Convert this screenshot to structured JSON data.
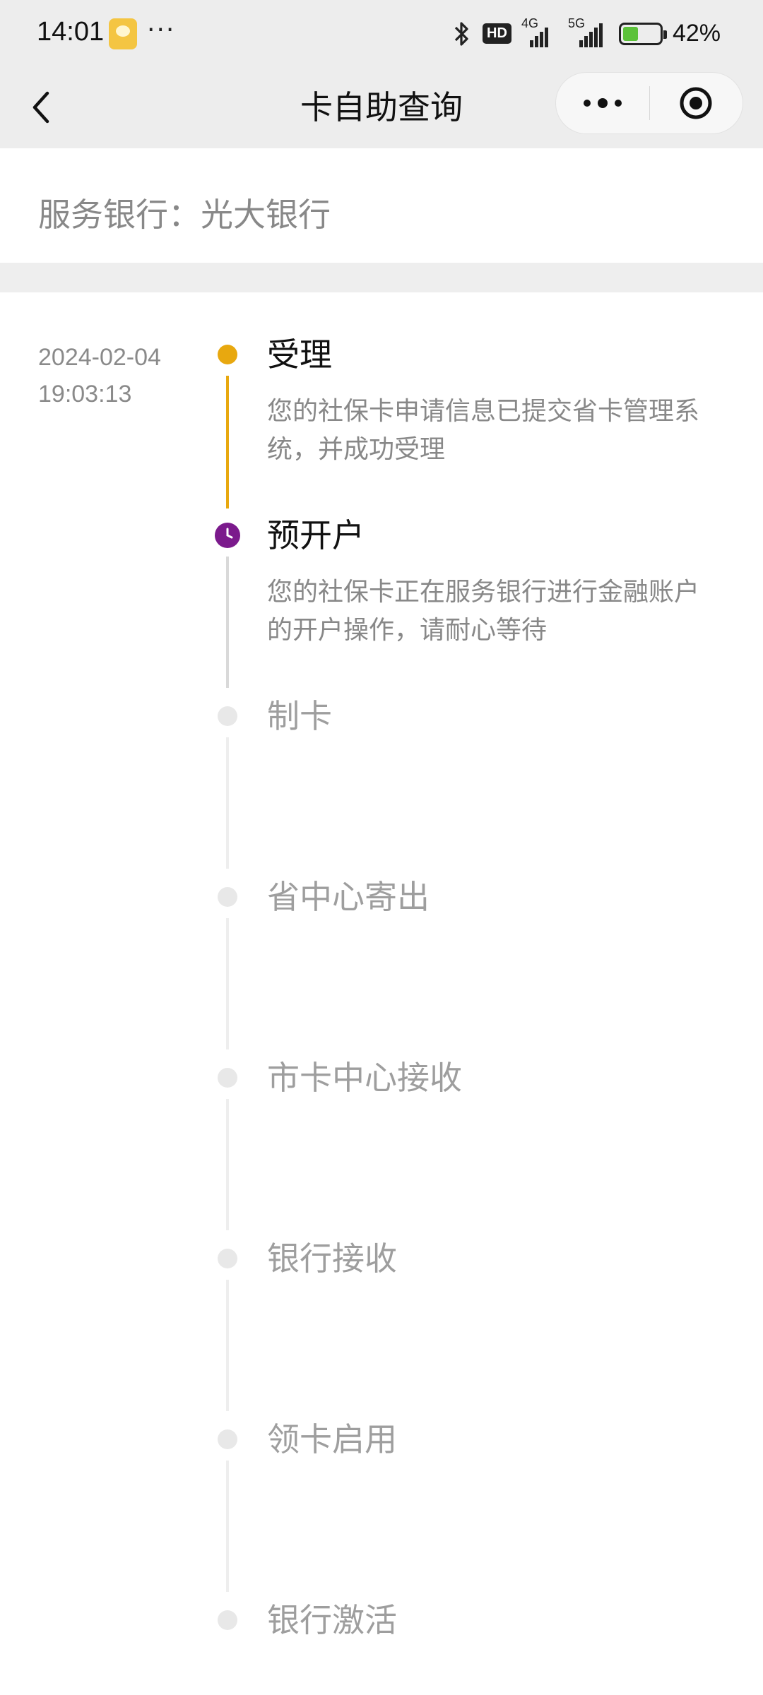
{
  "status_bar": {
    "time": "14:01",
    "dots": "···",
    "hd_label": "HD",
    "net1": "4G",
    "net2": "5G",
    "battery_text": "42%",
    "battery_level": 0.42
  },
  "nav": {
    "title": "卡自助查询",
    "back_icon": "chevron-left-icon",
    "more_icon": "more-dots-icon",
    "close_icon": "target-circle-icon"
  },
  "info": {
    "bank_line": "服务银行：光大银行"
  },
  "timeline": {
    "date": "2024-02-04",
    "time": "19:03:13",
    "steps": [
      {
        "title": "受理",
        "desc": "您的社保卡申请信息已提交省卡管理系统，并成功受理",
        "state": "done"
      },
      {
        "title": "预开户",
        "desc": "您的社保卡正在服务银行进行金融账户的开户操作，请耐心等待",
        "state": "current"
      },
      {
        "title": "制卡",
        "state": "pending"
      },
      {
        "title": "省中心寄出",
        "state": "pending"
      },
      {
        "title": "市卡中心接收",
        "state": "pending"
      },
      {
        "title": "银行接收",
        "state": "pending"
      },
      {
        "title": "领卡启用",
        "state": "pending"
      },
      {
        "title": "银行激活",
        "state": "pending"
      }
    ]
  },
  "colors": {
    "done": "#e8a80f",
    "current": "#7b1a8c",
    "pending_dot": "#e8e8e8",
    "pending_line": "#eeeeee",
    "current_line": "#d9d9d9"
  }
}
